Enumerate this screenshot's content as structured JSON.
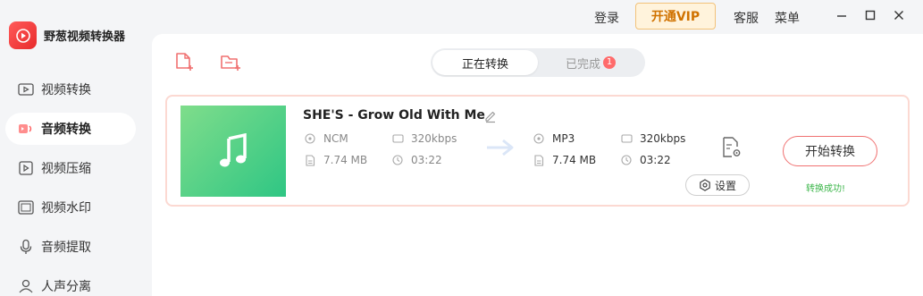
{
  "app": {
    "name": "野葱视频转换器"
  },
  "sidebar": {
    "items": [
      {
        "label": "视频转换",
        "icon": "video-convert-icon",
        "active": false
      },
      {
        "label": "音频转换",
        "icon": "audio-convert-icon",
        "active": true
      },
      {
        "label": "视频压缩",
        "icon": "video-compress-icon",
        "active": false
      },
      {
        "label": "视频水印",
        "icon": "video-watermark-icon",
        "active": false
      },
      {
        "label": "音频提取",
        "icon": "mic-icon",
        "active": false
      },
      {
        "label": "人声分离",
        "icon": "voice-separate-icon",
        "active": false
      }
    ]
  },
  "header": {
    "login": "登录",
    "vip": "开通VIP",
    "service": "客服",
    "menu": "菜单"
  },
  "toolbar": {
    "add_file_icon": "add-file-icon",
    "add_folder_icon": "add-folder-icon"
  },
  "tabs": {
    "converting": "正在转换",
    "completed": "已完成",
    "completed_count": "1"
  },
  "task": {
    "title": "SHE'S - Grow Old With Me",
    "source": {
      "format": "NCM",
      "bitrate": "320kbps",
      "size": "7.74 MB",
      "duration": "03:22"
    },
    "target": {
      "format": "MP3",
      "bitrate": "320kbps",
      "size": "7.74 MB",
      "duration": "03:22"
    },
    "settings_label": "设置",
    "start_label": "开始转换",
    "status": "转换成功!"
  },
  "colors": {
    "accent": "#f07171",
    "vip_text": "#d07200",
    "success": "#3cb64a",
    "thumb_start": "#7fdd8b",
    "thumb_end": "#2fc684"
  }
}
